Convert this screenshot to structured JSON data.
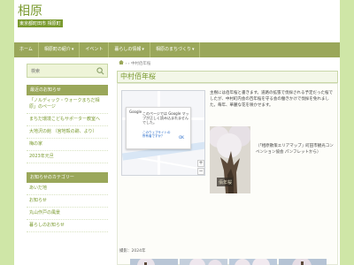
{
  "site": {
    "title": "相原",
    "tagline": "東京都町田市 相原町"
  },
  "nav": {
    "items": [
      {
        "label": "ホーム",
        "has_menu": false
      },
      {
        "label": "相原町の紹介",
        "has_menu": true
      },
      {
        "label": "イベント",
        "has_menu": false
      },
      {
        "label": "暮らしの情報",
        "has_menu": true
      },
      {
        "label": "相原のまちづくり",
        "has_menu": true
      }
    ]
  },
  "sidebar": {
    "search_placeholder": "検索",
    "recent_title": "最近のお知らせ",
    "recent_items": [
      "「ノルディック・ウォークまちだ相原」のページ",
      "まちだ環境こどもサポーター教室へ",
      "大地沢の館 （宮地殻の跡、より）",
      "梅の家",
      "2023年元旦"
    ],
    "category_title": "お知らせのカテゴリー",
    "category_items": [
      "あいだ地",
      "お知らせ",
      "丸山作戸の風景",
      "暮らしのお知らせ"
    ]
  },
  "breadcrumb": {
    "separator": "›",
    "current": "中村佰年桜"
  },
  "article": {
    "title": "中村佰年桜",
    "body": "主樹には佰年桜と書きます。道路の拡張で伐採される予定だった桜でしたが、中村町内会の百年桜を守る会の働きかけで伐採を免れました。毎年、華麗な花を咲かせます。",
    "photo_caption": "（「相原散策エリアマップ」町田市観光コンベンション協会 パンフレットから）",
    "built_year": "撮影：2024年",
    "map_dialog": {
      "brand": "Google",
      "message": "このページでは Google マップが正しく読み込まれませんでした。",
      "link": "このウェブサイトの所有者ですか？",
      "ok": "OK"
    },
    "map_controls": {
      "zoom_in": "+",
      "zoom_out": "−"
    }
  },
  "colors": {
    "background": "#cfe6a7",
    "nav": "#9aa75a",
    "accent": "#7a9a2f"
  }
}
